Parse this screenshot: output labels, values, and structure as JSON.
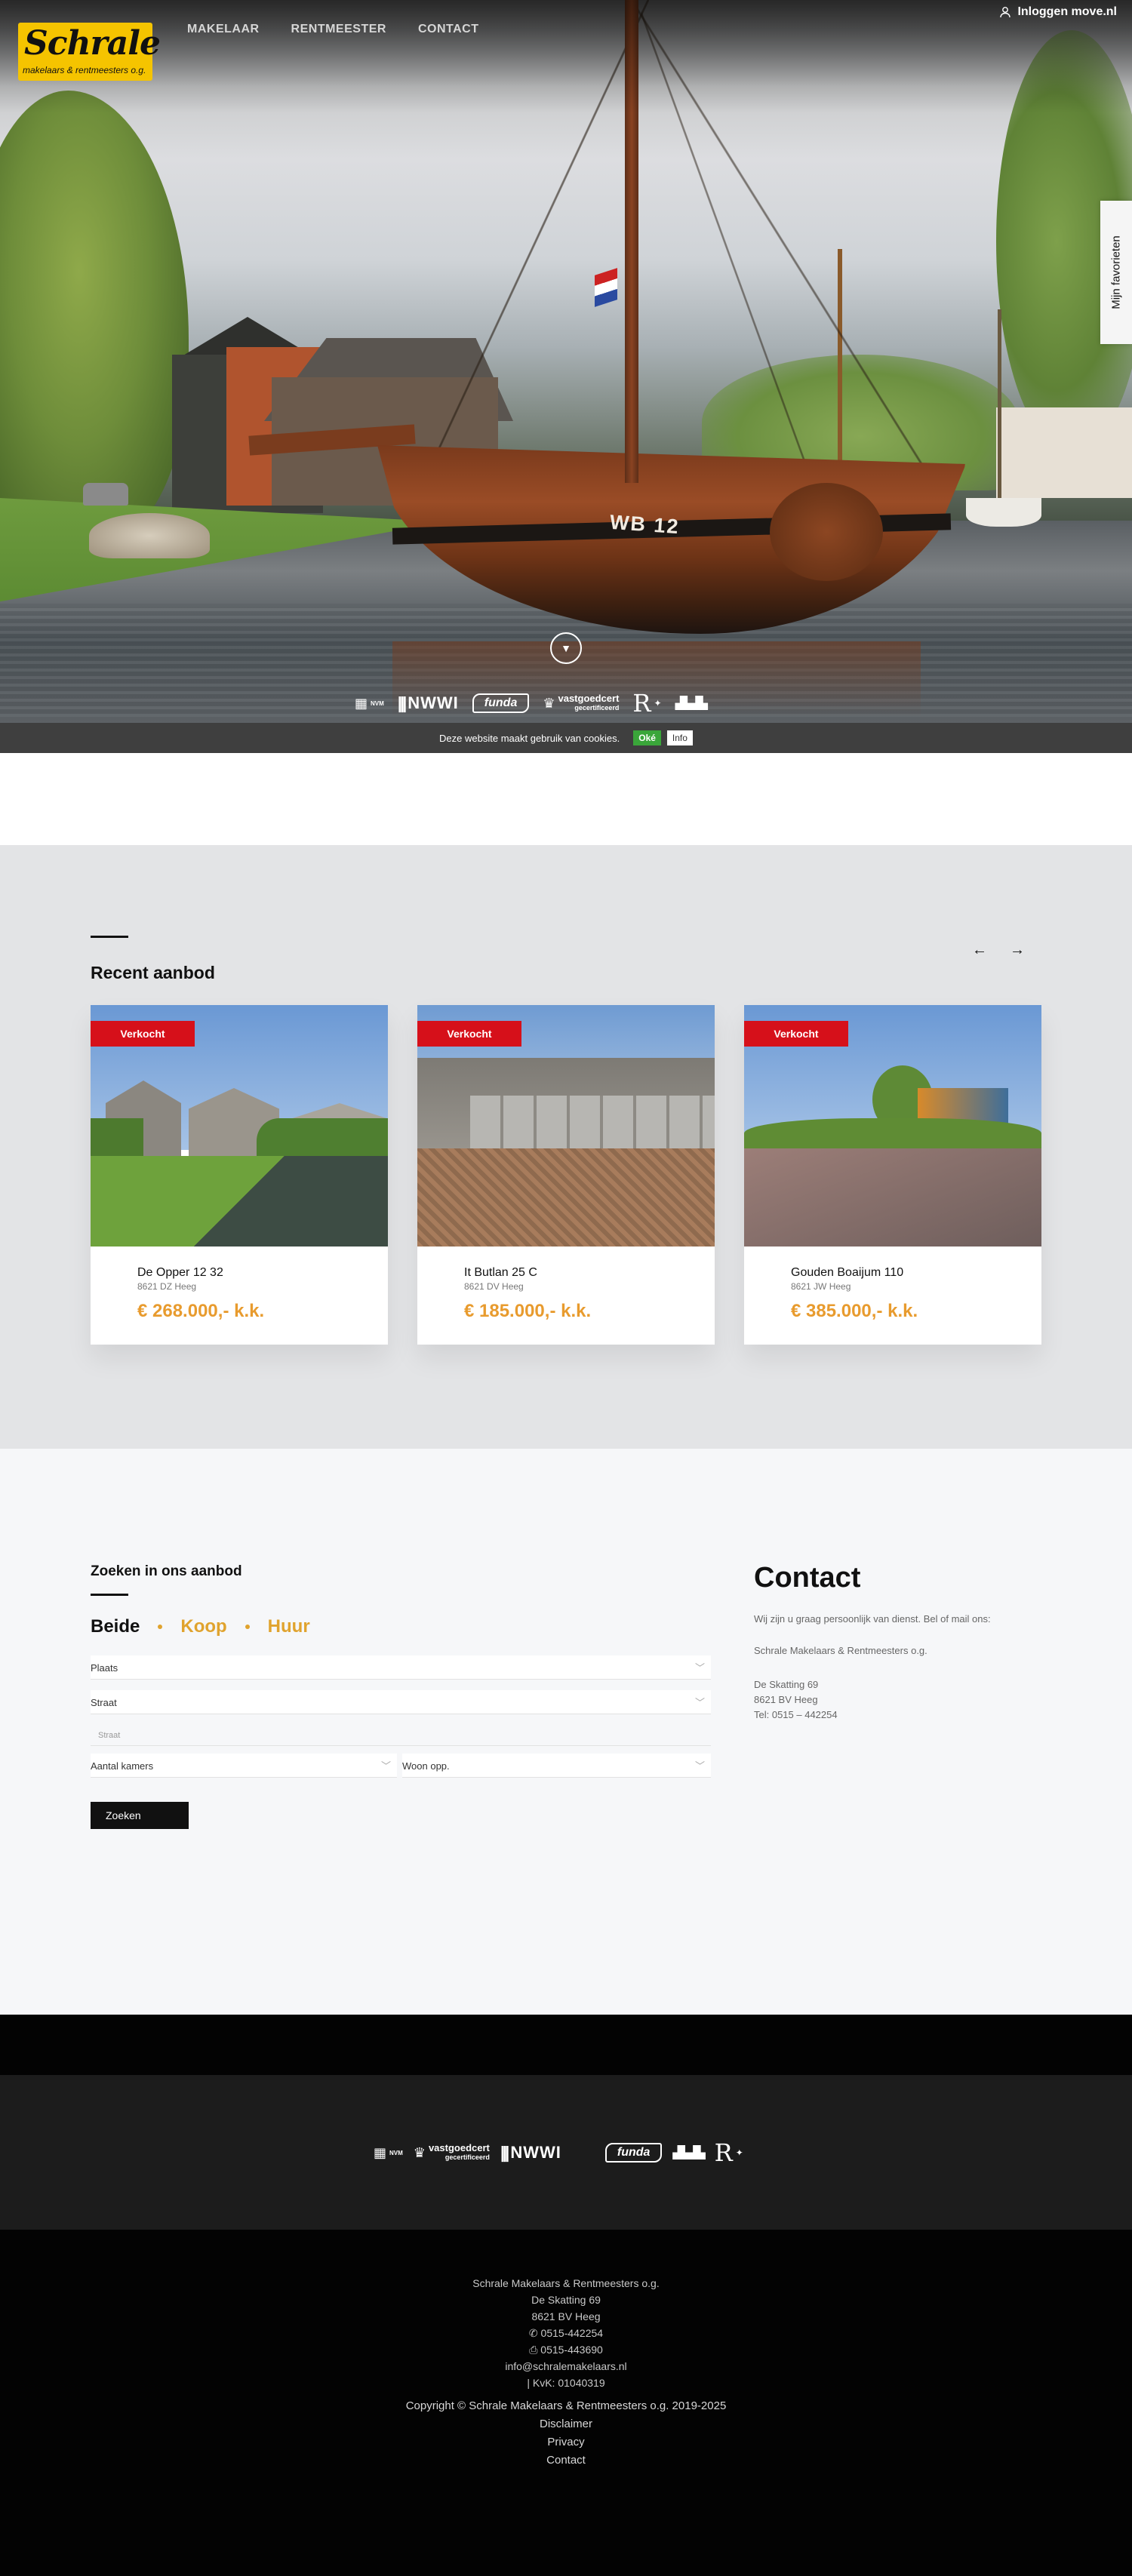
{
  "header": {
    "logo_name": "Schrale",
    "logo_sub": "makelaars & rentmeesters o.g.",
    "nav": [
      "MAKELAAR",
      "RENTMEESTER",
      "CONTACT"
    ],
    "login": "Inloggen move.nl",
    "favorites": "Mijn favorieten"
  },
  "hero": {
    "boat_text": "WB 12",
    "certs": {
      "nvm": "NVM",
      "nwwi": "NWWI",
      "funda": "funda",
      "vastgoedcert": "vastgoedcert",
      "vastgoedcert_sub": "gecertificeerd",
      "r": "R"
    }
  },
  "cookie": {
    "text": "Deze website maakt gebruik van cookies.",
    "ok": "Oké",
    "info": "Info"
  },
  "recent": {
    "title": "Recent aanbod",
    "cards": [
      {
        "badge": "Verkocht",
        "title": "De Opper 12 32",
        "sub": "8621 DZ Heeg",
        "price": "€ 268.000,- k.k."
      },
      {
        "badge": "Verkocht",
        "title": "It Butlan 25 C",
        "sub": "8621 DV Heeg",
        "price": "€ 185.000,- k.k."
      },
      {
        "badge": "Verkocht",
        "title": "Gouden Boaijum 110",
        "sub": "8621 JW Heeg",
        "price": "€ 385.000,- k.k."
      }
    ]
  },
  "search": {
    "title": "Zoeken in ons aanbod",
    "tabs": [
      "Beide",
      "Koop",
      "Huur"
    ],
    "plaats": "Plaats",
    "straat": "Straat",
    "straat_placeholder": "Straat",
    "kamers": "Aantal kamers",
    "woon": "Woon opp.",
    "button": "Zoeken"
  },
  "contact": {
    "title": "Contact",
    "intro": "Wij zijn u graag persoonlijk van dienst. Bel of mail ons:",
    "company": "Schrale Makelaars & Rentmeesters o.g.",
    "street": "De Skatting 69",
    "city": "8621 BV Heeg",
    "tel": "Tel: 0515 – 442254"
  },
  "footer": {
    "company": "Schrale Makelaars & Rentmeesters o.g.",
    "street": "De Skatting 69",
    "city": "8621 BV Heeg",
    "phone": "0515-442254",
    "fax": "0515-443690",
    "email": "info@schralemakelaars.nl",
    "kvk": "| KvK: 01040319",
    "copyright": "Copyright © Schrale Makelaars & Rentmeesters o.g. 2019-2025",
    "links": [
      "Disclaimer",
      "Privacy",
      "Contact"
    ]
  }
}
